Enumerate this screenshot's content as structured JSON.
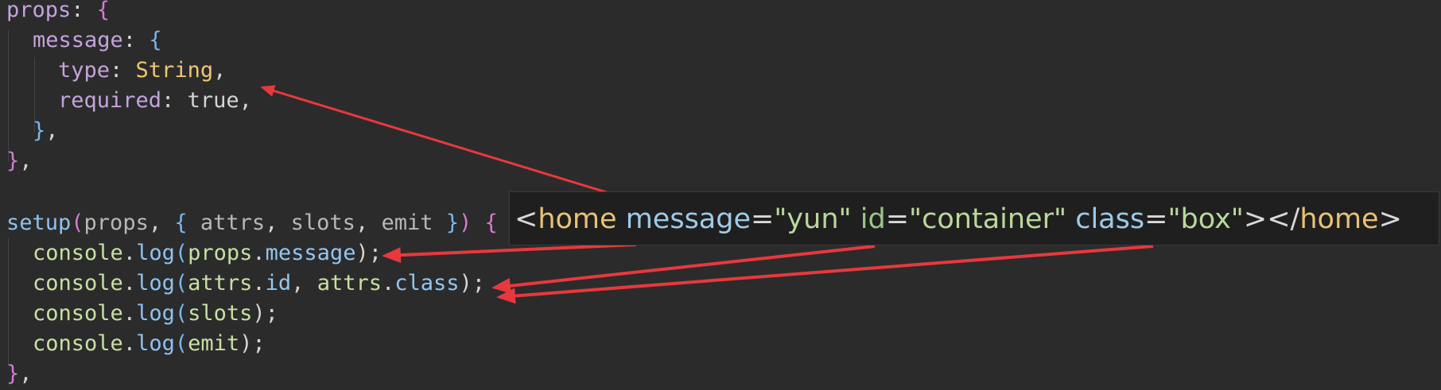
{
  "code": {
    "l1": {
      "props_key": "props",
      "colon": ": ",
      "open": "{"
    },
    "l2": {
      "message_key": "message",
      "colon": ": ",
      "open": "{"
    },
    "l3": {
      "type_key": "type",
      "colon": ": ",
      "value": "String",
      "comma": ","
    },
    "l4": {
      "required_key": "required",
      "colon": ": ",
      "value": "true",
      "comma": ","
    },
    "l5": {
      "close": "}",
      "comma": ","
    },
    "l6": {
      "close": "}",
      "comma": ","
    },
    "l8": {
      "fn": "setup",
      "p_open": "(",
      "param": "props",
      "sep1": ", ",
      "brace_open": "{ ",
      "a": "attrs",
      "sep2": ", ",
      "b": "slots",
      "sep3": ", ",
      "c": "emit",
      "brace_close": " }",
      "p_close": ")",
      "space": " ",
      "body_open": "{"
    },
    "l9": {
      "obj": "console",
      "dot": ".",
      "fn": "log",
      "open": "(",
      "a": "props",
      "dot2": ".",
      "b": "message",
      "close": ");"
    },
    "l10": {
      "obj": "console",
      "dot": ".",
      "fn": "log",
      "open": "(",
      "a": "attrs",
      "dot2": ".",
      "b": "id",
      "sep": ", ",
      "c": "attrs",
      "dot3": ".",
      "d": "class",
      "close": ");"
    },
    "l11": {
      "obj": "console",
      "dot": ".",
      "fn": "log",
      "open": "(",
      "a": "slots",
      "close": ");"
    },
    "l12": {
      "obj": "console",
      "dot": ".",
      "fn": "log",
      "open": "(",
      "a": "emit",
      "close": ");"
    },
    "l13": {
      "close": "}",
      "comma": ","
    }
  },
  "snippet": {
    "lt": "<",
    "tag": "home",
    "attr1": "message",
    "eq1": "=",
    "val1": "\"yun\"",
    "attr2": "id",
    "eq2": "=",
    "val2": "\"container\"",
    "attr3": "class",
    "eq3": "=",
    "val3": "\"box\"",
    "gt_close": "></",
    "tag_close": "home",
    "gt": ">"
  },
  "colors": {
    "background": "#2b2b2b",
    "arrow": "#e8383d"
  }
}
